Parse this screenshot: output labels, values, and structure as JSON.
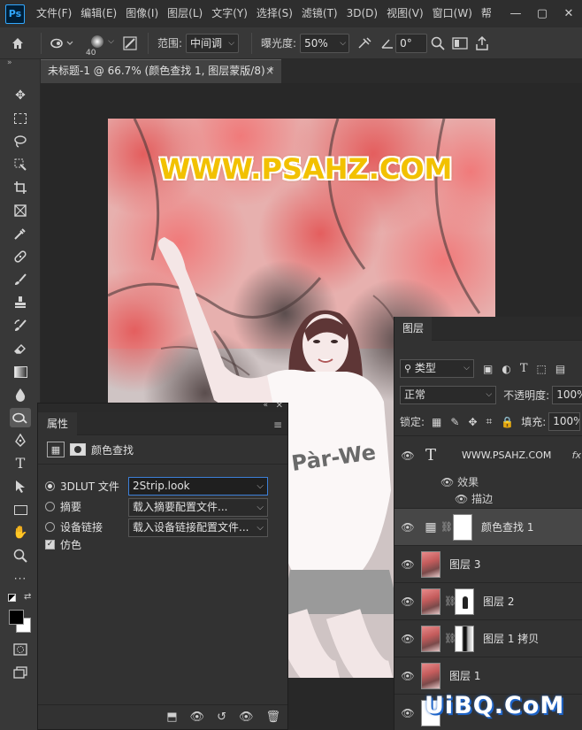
{
  "menubar": {
    "logo": "Ps",
    "items": [
      "文件(F)",
      "编辑(E)",
      "图像(I)",
      "图层(L)",
      "文字(Y)",
      "选择(S)",
      "滤镜(T)",
      "3D(D)",
      "视图(V)",
      "窗口(W)",
      "帮"
    ],
    "controls": [
      "—",
      "▢",
      "✕"
    ]
  },
  "options": {
    "brush_size": "40",
    "range_label": "范围:",
    "range_value": "中间调",
    "exposure_label": "曝光度:",
    "exposure_value": "50%",
    "angle_value": "0°"
  },
  "document": {
    "tab_title": "未标题-1 @ 66.7% (颜色查找 1, 图层蒙版/8) *",
    "close": "×"
  },
  "canvas": {
    "watermark": "WWW.PSAHZ.COM"
  },
  "properties": {
    "title": "属性",
    "adjustment_name": "颜色查找",
    "lut_label": "3DLUT 文件",
    "lut_value": "2Strip.look",
    "abstract_label": "摘要",
    "abstract_value": "载入摘要配置文件...",
    "device_link_label": "设备链接",
    "device_link_value": "载入设备链接配置文件...",
    "dither_label": "仿色"
  },
  "layers_panel": {
    "title": "图层",
    "filter_label": "类型",
    "blend_mode": "正常",
    "opacity_label": "不透明度:",
    "opacity_value": "100%",
    "lock_label": "锁定:",
    "fill_label": "填充:",
    "fill_value": "100%",
    "layers": [
      {
        "name": "WWW.PSAHZ.COM",
        "fx": "fx"
      },
      {
        "name": "效果"
      },
      {
        "name": "描边"
      },
      {
        "name": "颜色查找 1"
      },
      {
        "name": "图层 3"
      },
      {
        "name": "图层 2"
      },
      {
        "name": "图层 1 拷贝"
      },
      {
        "name": "图层 1"
      },
      {
        "name": ""
      }
    ]
  },
  "watermark_site": "UiBQ.CoM"
}
